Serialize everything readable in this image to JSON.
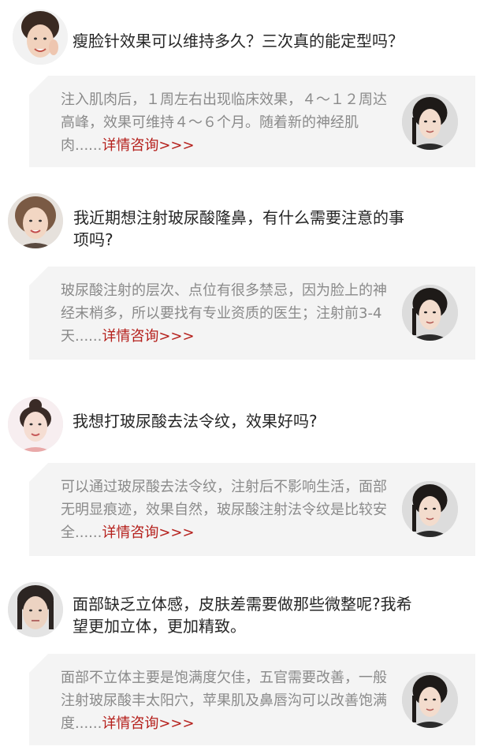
{
  "qa_items": [
    {
      "question": "瘦脸针效果可以维持多久？三次真的能定型吗？",
      "answer": "注入肌肉后，１周左右出现临床效果，４～１２周达高峰，效果可维持４～６个月。随着新的神经肌肉......",
      "more_link": "详情咨询>>>"
    },
    {
      "question": "我近期想注射玻尿酸隆鼻，有什么需要注意的事项吗?",
      "answer": "玻尿酸注射的层次、点位有很多禁忌，因为脸上的神经末梢多，所以要找有专业资质的医生；注射前3-4天......",
      "more_link": "详情咨询>>>"
    },
    {
      "question": "我想打玻尿酸去法令纹，效果好吗?",
      "answer": "可以通过玻尿酸去法令纹，注射后不影响生活，面部无明显痕迹，效果自然，玻尿酸注射法令纹是比较安全......",
      "more_link": "详情咨询>>>"
    },
    {
      "question": "面部缺乏立体感，皮肤差需要做那些微整呢?我希望更加立体，更加精致。",
      "answer": "面部不立体主要是饱满度欠佳，五官需要改善，一般注射玻尿酸丰太阳穴，苹果肌及鼻唇沟可以改善饱满度......",
      "more_link": "详情咨询>>>"
    }
  ],
  "colors": {
    "link": "#b5201c",
    "answer_text": "#8a8a8a",
    "answer_bg": "#f4f4f4"
  }
}
